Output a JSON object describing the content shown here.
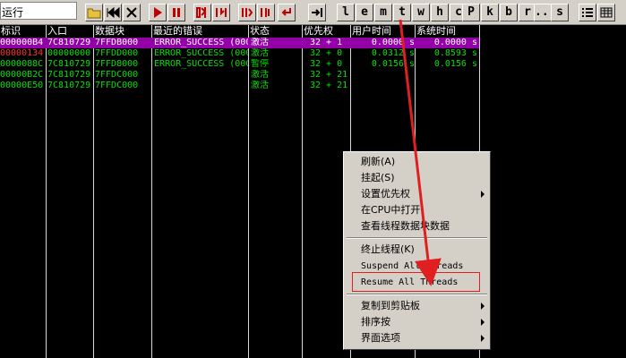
{
  "toolbar": {
    "status": "运行",
    "letters": [
      "l",
      "e",
      "m",
      "t",
      "w",
      "h",
      "c",
      "P",
      "k",
      "b",
      "r",
      "...",
      "s"
    ]
  },
  "columns": [
    {
      "label": "标识"
    },
    {
      "label": "入口"
    },
    {
      "label": "数据块"
    },
    {
      "label": "最近的错误"
    },
    {
      "label": "状态"
    },
    {
      "label": "优先权"
    },
    {
      "label": "用户时间"
    },
    {
      "label": "系统时间"
    }
  ],
  "rows": [
    {
      "id": "000000B4",
      "entry": "7C810729",
      "block": "7FFDB000",
      "error": "ERROR_SUCCESS  (000",
      "state": "激活",
      "priority": "32 + 1",
      "user": "0.0000 s",
      "sys": "0.0000 s",
      "selected": true
    },
    {
      "id": "00000134",
      "entry": "00000000",
      "block": "7FFDD000",
      "error": "ERROR_SUCCESS  (000",
      "state": "激活",
      "priority": "32 + 0",
      "user": "0.0312 s",
      "sys": "0.8593 s",
      "selected": false
    },
    {
      "id": "0000088C",
      "entry": "7C810729",
      "block": "7FFD8000",
      "error": "ERROR_SUCCESS  (000",
      "state": "暂停",
      "priority": "32 + 0",
      "user": "0.0156 s",
      "sys": "0.0156 s",
      "selected": false
    },
    {
      "id": "00000B2C",
      "entry": "7C810729",
      "block": "7FFDC000",
      "error": "",
      "state": "激活",
      "priority": "32 + 21",
      "user": "",
      "sys": "",
      "selected": false
    },
    {
      "id": "00000E50",
      "entry": "7C810729",
      "block": "7FFDC000",
      "error": "",
      "state": "激活",
      "priority": "32 + 21",
      "user": "",
      "sys": "",
      "selected": false
    }
  ],
  "menu": {
    "items": [
      "刷新(A)",
      "挂起(S)",
      "设置优先权",
      "在CPU中打开",
      "查看线程数据块数据",
      "终止线程(K)",
      "Suspend All Threads",
      "Resume All Threads",
      "复制到剪贴板",
      "排序按",
      "界面选项"
    ]
  },
  "colors": {
    "selected_row": "#9400a8",
    "text_green": "#00e000",
    "text_red": "#ff3030",
    "annotation": "#e02020"
  }
}
